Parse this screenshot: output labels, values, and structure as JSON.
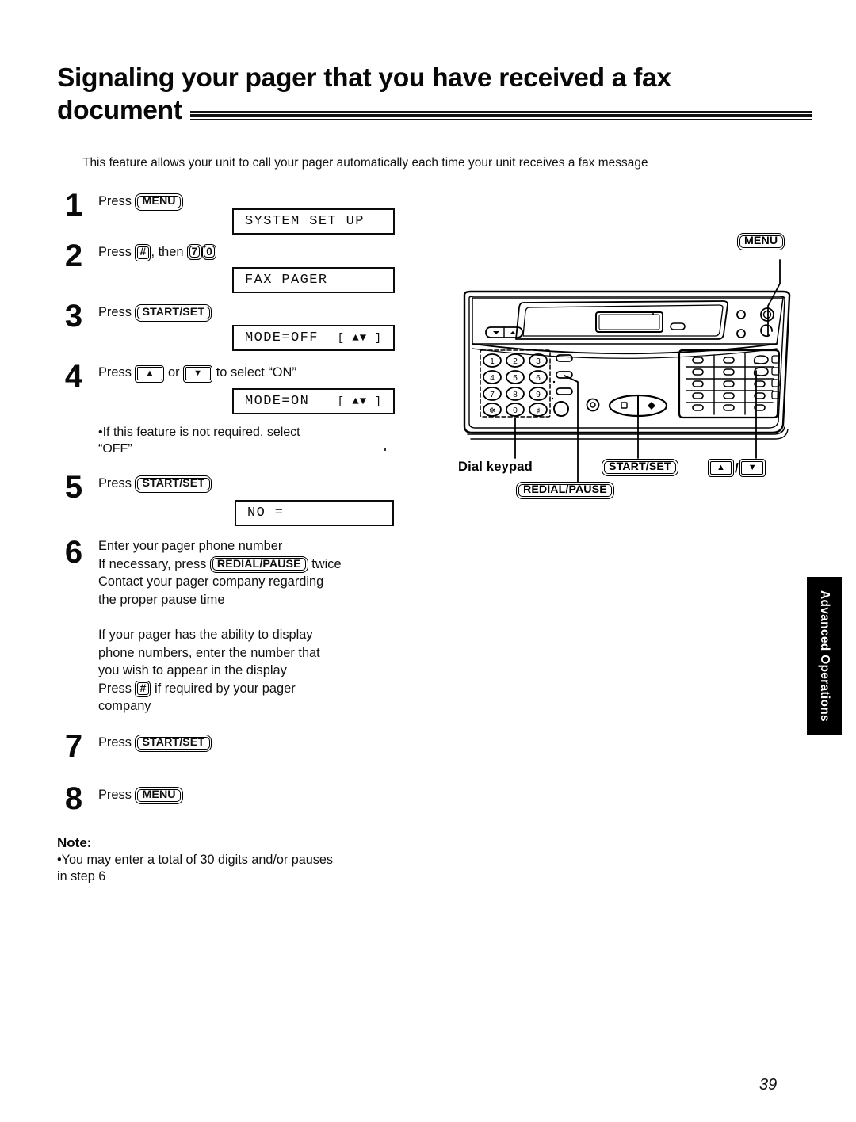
{
  "title": {
    "line1": "Signaling your pager that you have received a fax",
    "line2": "document"
  },
  "intro": "This feature allows your unit to call your pager automatically each time your unit receives a fax message",
  "steps": [
    {
      "number": "1",
      "press_label": "Press",
      "key": "MENU",
      "display": {
        "left": "SYSTEM SET UP",
        "right": ""
      }
    },
    {
      "number": "2",
      "press_label": "Press",
      "key": "#",
      "then_label": ", then",
      "digit1": "7",
      "digit2": "0",
      "display": {
        "left": "FAX PAGER",
        "right": ""
      }
    },
    {
      "number": "3",
      "press_label": "Press",
      "key": "START/SET",
      "display": {
        "left": "MODE=OFF",
        "right": "[ ▲▼ ]"
      }
    },
    {
      "number": "4",
      "press_label": "Press",
      "key_up": "▲",
      "or_label": "or",
      "key_down": "▼",
      "tail_label": "to select “ON”",
      "display": {
        "left": "MODE=ON",
        "right": "[ ▲▼ ]"
      },
      "bullet_line1": "•If this feature is not required, select",
      "bullet_line2": "“OFF”"
    },
    {
      "number": "5",
      "press_label": "Press",
      "key": "START/SET",
      "display": {
        "left": "NO  =",
        "right": ""
      }
    },
    {
      "number": "6",
      "para1_line1": "Enter your pager phone number",
      "para1_pre": "If necessary, press",
      "para1_key": "REDIAL/PAUSE",
      "para1_post": "twice",
      "para1_line3": "Contact your pager company regarding",
      "para1_line4": "the proper pause time",
      "para2_line1": "If your pager has the ability to display",
      "para2_line2": "phone numbers, enter the number that",
      "para2_line3": "you wish to appear in the display",
      "para2_pre": "Press",
      "para2_key": "#",
      "para2_post": "if required by your pager",
      "para2_line5": "company"
    },
    {
      "number": "7",
      "press_label": "Press",
      "key": "START/SET"
    },
    {
      "number": "8",
      "press_label": "Press",
      "key": "MENU"
    }
  ],
  "note": {
    "title": "Note:",
    "line1": "•You may enter a total of 30 digits and/or pauses",
    "line2": "in step 6"
  },
  "illustration": {
    "callout_menu": "MENU",
    "callout_dial_keypad": "Dial keypad",
    "callout_redial_pause": "REDIAL/PAUSE",
    "callout_start_set": "START/SET",
    "callout_arrow_up": "▲",
    "callout_arrow_separator": "/",
    "callout_arrow_down": "▼",
    "keypad_keys": [
      "1",
      "2",
      "3",
      "4",
      "5",
      "6",
      "7",
      "8",
      "9",
      "✱",
      "0",
      "♯"
    ]
  },
  "side_tab": {
    "label": "Advanced Operations"
  },
  "page_number": "39",
  "colors": {
    "ink": "#0a0a0a",
    "paper": "#ffffff",
    "tab_background": "#000000",
    "tab_text": "#ffffff"
  }
}
